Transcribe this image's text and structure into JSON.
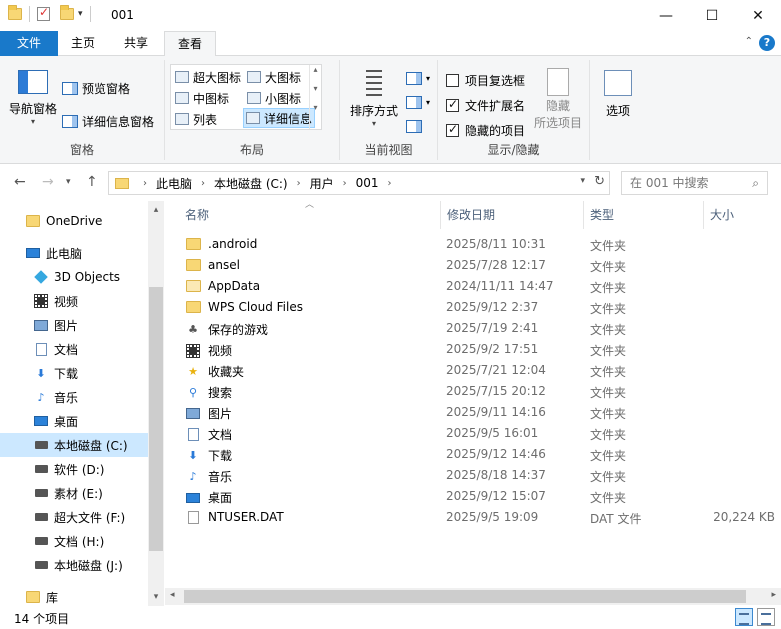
{
  "window": {
    "title": "001",
    "minimize_glyph": "—",
    "maximize_glyph": "☐",
    "close_glyph": "✕"
  },
  "ribbon_tabs": {
    "file": "文件",
    "home": "主页",
    "share": "共享",
    "view": "查看",
    "collapse_glyph": "⌃",
    "help_glyph": "?"
  },
  "ribbon": {
    "pane_group": {
      "label": "窗格",
      "nav_pane": "导航窗格",
      "preview_pane": "预览窗格",
      "details_pane": "详细信息窗格"
    },
    "layout_group": {
      "label": "布局",
      "items": [
        "超大图标",
        "大图标",
        "中图标",
        "小图标",
        "列表",
        "详细信息"
      ]
    },
    "current_view_group": {
      "label": "当前视图",
      "sort_by": "排序方式"
    },
    "show_hide_group": {
      "label": "显示/隐藏",
      "item_checkboxes": "项目复选框",
      "file_extensions": "文件扩展名",
      "hidden_items": "隐藏的项目",
      "hide_selected": "隐藏\n所选项目",
      "item_checkboxes_checked": false,
      "file_extensions_checked": true,
      "hidden_items_checked": true
    },
    "options_group": {
      "label": "选项"
    }
  },
  "address": {
    "crumbs": [
      "此电脑",
      "本地磁盘 (C:)",
      "用户",
      "001"
    ],
    "search_placeholder": "在 001 中搜索"
  },
  "nav_pane": {
    "items": [
      {
        "label": "OneDrive",
        "icon": "folder-icon"
      },
      {
        "label": "此电脑",
        "icon": "computer-icon"
      },
      {
        "label": "3D Objects",
        "icon": "3d-objects-icon"
      },
      {
        "label": "视频",
        "icon": "video-icon"
      },
      {
        "label": "图片",
        "icon": "pictures-icon"
      },
      {
        "label": "文档",
        "icon": "documents-icon"
      },
      {
        "label": "下载",
        "icon": "download-icon"
      },
      {
        "label": "音乐",
        "icon": "music-icon"
      },
      {
        "label": "桌面",
        "icon": "desktop-icon"
      },
      {
        "label": "本地磁盘 (C:)",
        "icon": "drive-icon"
      },
      {
        "label": "软件 (D:)",
        "icon": "drive-icon"
      },
      {
        "label": "素材 (E:)",
        "icon": "drive-icon"
      },
      {
        "label": "超大文件 (F:)",
        "icon": "drive-icon"
      },
      {
        "label": "文档 (H:)",
        "icon": "drive-icon"
      },
      {
        "label": "本地磁盘 (J:)",
        "icon": "drive-icon"
      },
      {
        "label": "库",
        "icon": "library-icon"
      }
    ]
  },
  "file_list": {
    "columns": [
      "名称",
      "修改日期",
      "类型",
      "大小"
    ],
    "rows": [
      {
        "name": ".android",
        "date": "2025/8/11 10:31",
        "type": "文件夹",
        "size": "",
        "icon": "folder-icon"
      },
      {
        "name": "ansel",
        "date": "2025/7/28 12:17",
        "type": "文件夹",
        "size": "",
        "icon": "folder-icon"
      },
      {
        "name": "AppData",
        "date": "2024/11/11 14:47",
        "type": "文件夹",
        "size": "",
        "icon": "folder-hidden-icon"
      },
      {
        "name": "WPS Cloud Files",
        "date": "2025/9/12 2:37",
        "type": "文件夹",
        "size": "",
        "icon": "folder-icon"
      },
      {
        "name": "保存的游戏",
        "date": "2025/7/19 2:41",
        "type": "文件夹",
        "size": "",
        "icon": "saved-games-icon"
      },
      {
        "name": "视频",
        "date": "2025/9/2 17:51",
        "type": "文件夹",
        "size": "",
        "icon": "video-icon"
      },
      {
        "name": "收藏夹",
        "date": "2025/7/21 12:04",
        "type": "文件夹",
        "size": "",
        "icon": "favorites-icon"
      },
      {
        "name": "搜索",
        "date": "2025/7/15 20:12",
        "type": "文件夹",
        "size": "",
        "icon": "search-icon"
      },
      {
        "name": "图片",
        "date": "2025/9/11 14:16",
        "type": "文件夹",
        "size": "",
        "icon": "pictures-icon"
      },
      {
        "name": "文档",
        "date": "2025/9/5 16:01",
        "type": "文件夹",
        "size": "",
        "icon": "documents-icon"
      },
      {
        "name": "下载",
        "date": "2025/9/12 14:46",
        "type": "文件夹",
        "size": "",
        "icon": "download-icon"
      },
      {
        "name": "音乐",
        "date": "2025/8/18 14:37",
        "type": "文件夹",
        "size": "",
        "icon": "music-icon"
      },
      {
        "name": "桌面",
        "date": "2025/9/12 15:07",
        "type": "文件夹",
        "size": "",
        "icon": "desktop-icon"
      },
      {
        "name": "NTUSER.DAT",
        "date": "2025/9/5 19:09",
        "type": "DAT 文件",
        "size": "20,224 KB",
        "icon": "file-icon"
      }
    ]
  },
  "status": {
    "item_count": "14 个项目"
  },
  "colors": {
    "accent": "#1979ca",
    "selection": "#cce8ff",
    "header_text": "#4c607a"
  }
}
